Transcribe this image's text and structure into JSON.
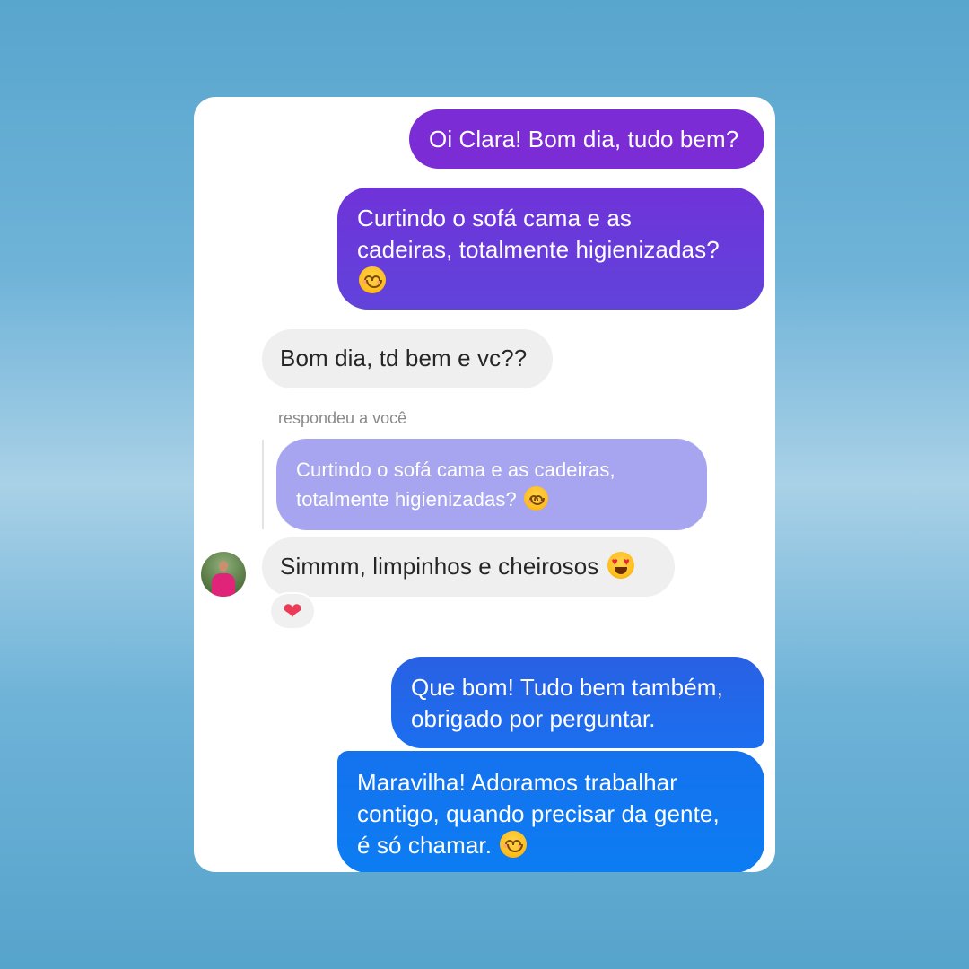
{
  "messages": [
    {
      "id": "m1",
      "from": "me",
      "text": "Oi Clara! Bom dia, tudo bem?"
    },
    {
      "id": "m2",
      "from": "me",
      "line1": "Curtindo o sofá cama e as",
      "line2": "cadeiras, totalmente higienizadas?",
      "emoji": "smiling-face-with-smiling-eyes"
    },
    {
      "id": "m3",
      "from": "them",
      "text": "Bom dia, td bem e vc??"
    },
    {
      "id": "m4",
      "from": "them",
      "text": "Simmm, limpinhos e cheirosos",
      "emoji": "smiling-face-with-heart-eyes",
      "reaction": "red-heart"
    },
    {
      "id": "m5",
      "from": "me",
      "line1": "Que bom! Tudo bem também,",
      "line2": "obrigado por perguntar."
    },
    {
      "id": "m6",
      "from": "me",
      "line1": "Maravilha! Adoramos trabalhar",
      "line2": "contigo, quando precisar da gente,",
      "line3": "é só chamar.",
      "emoji": "smiling-face"
    }
  ],
  "reply": {
    "label": "respondeu a você",
    "quote_line1": "Curtindo o sofá cama e as cadeiras,",
    "quote_line2": "totalmente higienizadas?",
    "emoji": "smiling-face-with-smiling-eyes"
  },
  "colors": {
    "sent_top": "#7b2dd6",
    "sent_mid": "#5e3fd9",
    "sent_bottom": "#0f7cf0",
    "received": "#efefef",
    "quoted": "#a7a4ef",
    "background": "#5aa6ce"
  }
}
